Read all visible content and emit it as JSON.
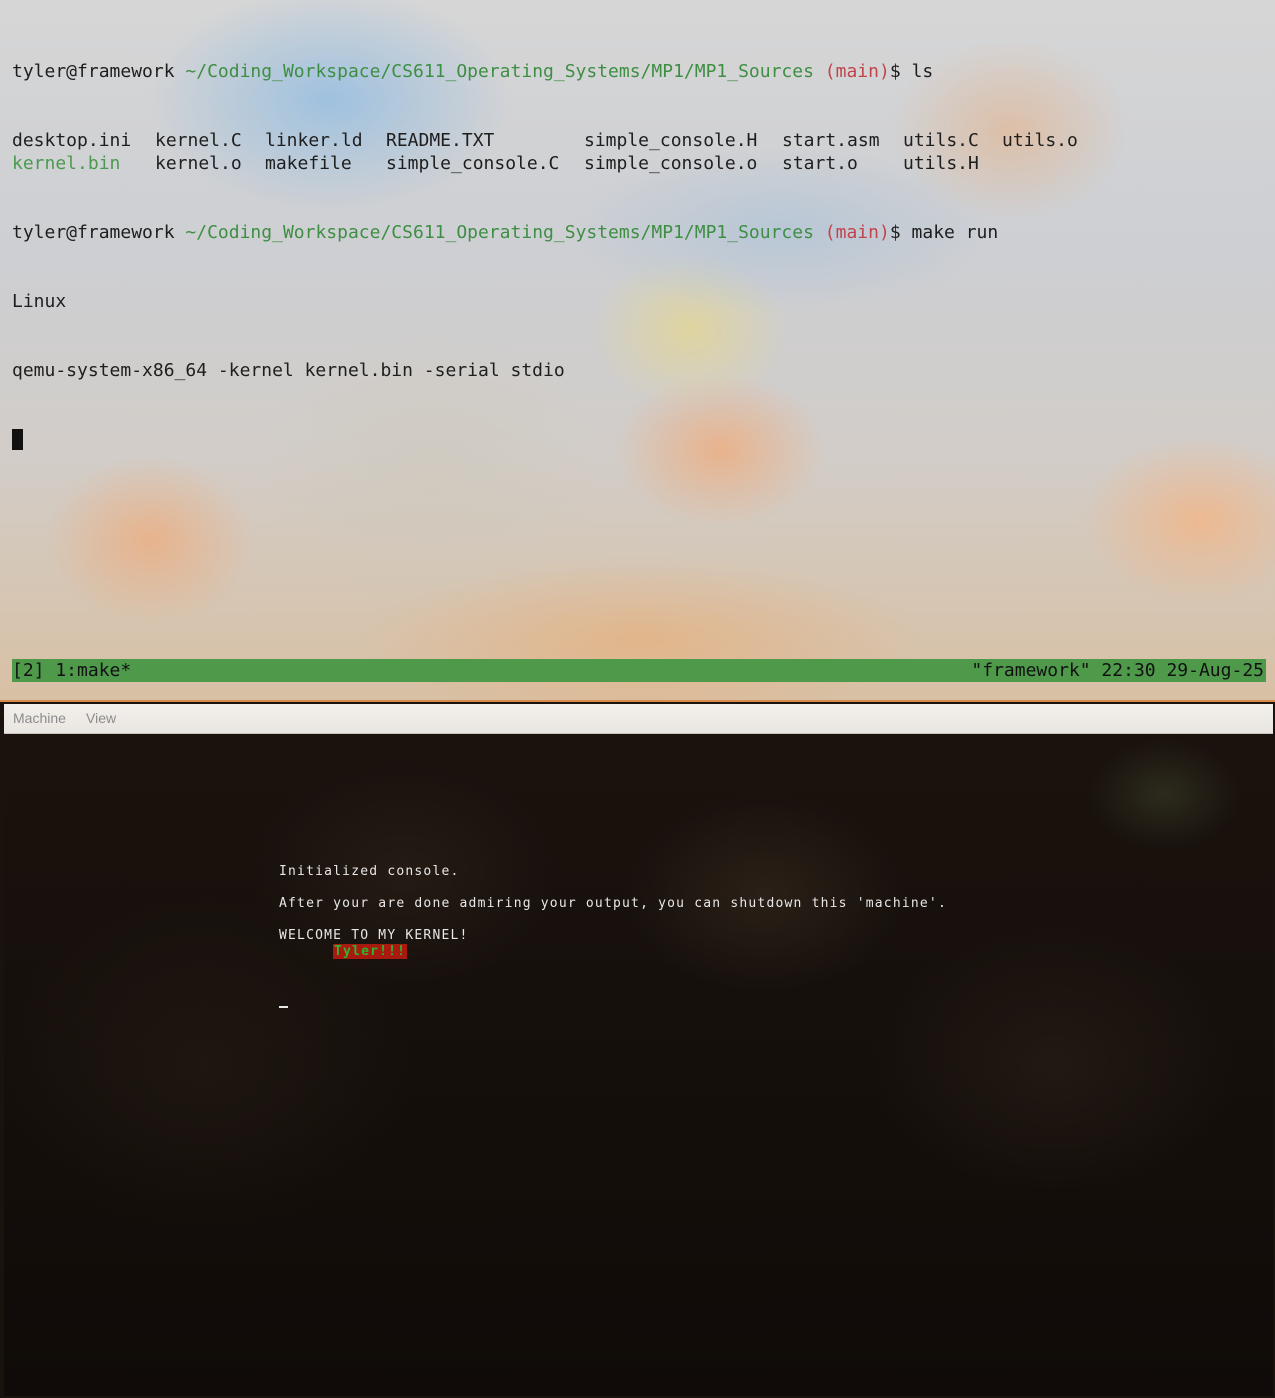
{
  "terminal": {
    "prompt1": {
      "user_host": "tyler@framework",
      "path": "~/Coding_Workspace/CS611_Operating_Systems/MP1/MP1_Sources",
      "branch": "(main)",
      "symbol": "$",
      "command": "ls"
    },
    "ls_output": {
      "row1": [
        "desktop.ini",
        "kernel.C",
        "linker.ld",
        "README.TXT",
        "simple_console.H",
        "start.asm",
        "utils.C",
        "utils.o"
      ],
      "row2": [
        "kernel.bin",
        "kernel.o",
        "makefile",
        "simple_console.C",
        "simple_console.o",
        "start.o",
        "utils.H"
      ]
    },
    "prompt2": {
      "user_host": "tyler@framework",
      "path": "~/Coding_Workspace/CS611_Operating_Systems/MP1/MP1_Sources",
      "branch": "(main)",
      "symbol": "$",
      "command": "make run"
    },
    "output_lines": [
      "Linux",
      "qemu-system-x86_64 -kernel kernel.bin -serial stdio"
    ],
    "statusbar": {
      "left": "[2] 1:make*",
      "right": "\"framework\" 22:30 29-Aug-25"
    },
    "colors": {
      "path": "#3e8e43",
      "branch": "#c0444a",
      "statusbar": "#4e9a4a",
      "executable": "#4b9a4f"
    }
  },
  "qemu": {
    "menu": [
      "Machine",
      "View"
    ],
    "console": {
      "line1": "Initialized console.",
      "line2": "After your are done admiring your output, you can shutdown this 'machine'.",
      "line3": "WELCOME TO MY KERNEL!",
      "highlight": "Tyler!!!"
    },
    "colors": {
      "highlight_bg": "#a81a10",
      "highlight_fg": "#2fb52a"
    }
  }
}
